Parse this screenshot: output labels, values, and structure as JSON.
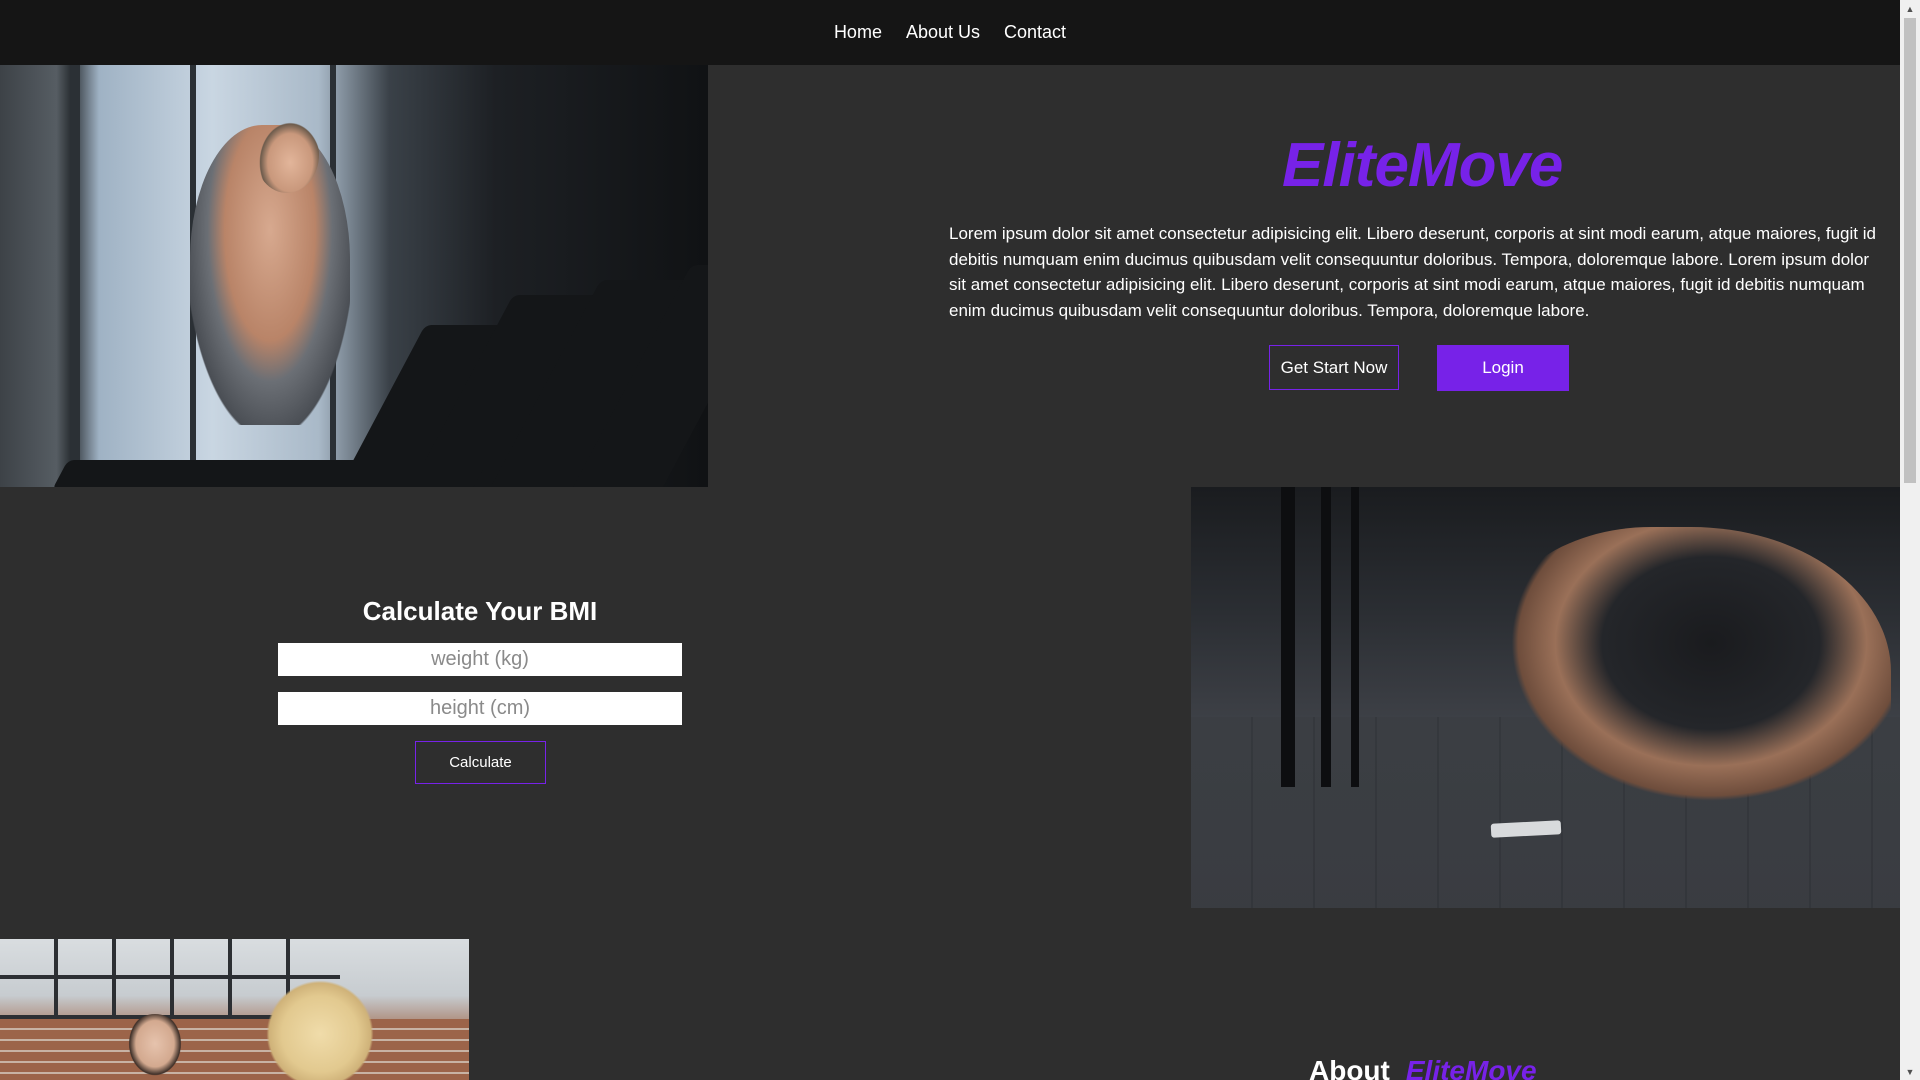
{
  "nav": {
    "items": [
      {
        "label": "Home"
      },
      {
        "label": "About Us"
      },
      {
        "label": "Contact"
      }
    ]
  },
  "hero": {
    "brand": "EliteMove",
    "description": "Lorem ipsum dolor sit amet consectetur adipisicing elit. Libero deserunt, corporis at sint modi earum, atque maiores, fugit id debitis numquam enim ducimus quibusdam velit consequuntur doloribus. Tempora, doloremque labore.   Lorem ipsum dolor sit amet consectetur adipisicing elit. Libero deserunt, corporis at sint modi earum, atque maiores, fugit id debitis numquam enim ducimus quibusdam velit consequuntur doloribus. Tempora, doloremque labore.",
    "primary_button": "Get Start Now",
    "secondary_button": "Login"
  },
  "bmi": {
    "title": "Calculate Your BMI",
    "weight_placeholder": "weight (kg)",
    "height_placeholder": "height (cm)",
    "weight_value": "",
    "height_value": "",
    "button": "Calculate"
  },
  "about": {
    "heading": "About",
    "brand": "EliteMove"
  },
  "theme": {
    "accent": "#7722e8",
    "background": "#2e2e2e",
    "navbar": "#151515"
  },
  "icons": {
    "scroll_up": "triangle-up-icon",
    "scroll_down": "triangle-down-icon"
  }
}
